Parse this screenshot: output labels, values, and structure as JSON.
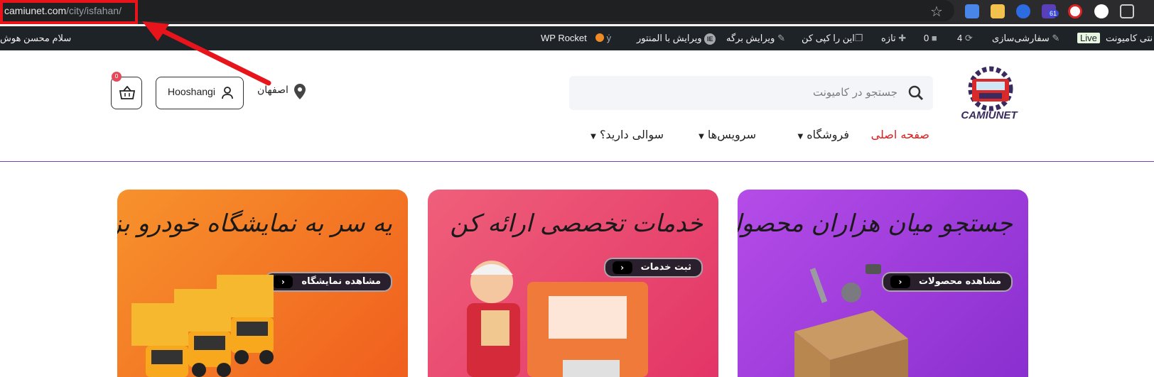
{
  "browser": {
    "url_domain": "camiunet.com",
    "url_path": "/city/isfahan/",
    "ext_badge": "61"
  },
  "adminbar": {
    "site_name": "نتی کامیونت",
    "live_label": "Live",
    "customize": "سفارشی‌سازی",
    "updates_count": "4",
    "comments_count": "0",
    "new": "تازه",
    "copy": "این را کپی کن",
    "edit_page": "ویرایش برگه",
    "edit_elementor": "ویرایش با المنتور",
    "wp_rocket": "WP Rocket",
    "greeting": "سلام محسن هوش"
  },
  "header": {
    "search_placeholder": "جستجو در کامیونت",
    "location": "اصفهان",
    "user_label": "Hooshangi",
    "cart_count": "0",
    "logo_text": "CAMIUNET"
  },
  "nav": {
    "home": "صفحه اصلی",
    "shop": "فروشگاه",
    "services": "سرویس‌ها",
    "faq": "سوالی دارید؟"
  },
  "cards": [
    {
      "title": "جستجو میان هزاران محصول",
      "button": "مشاهده محصولات",
      "color": "#9a3ad8"
    },
    {
      "title": "خدمات تخصصی ارائه کن",
      "button": "ثبت خدمات",
      "color": "#e8456c"
    },
    {
      "title": "یه سر به نمایشگاه خودرو بزن",
      "button": "مشاهده نمایشگاه",
      "color": "#f26a1f"
    }
  ],
  "colors": {
    "accent_red": "#e8141c",
    "nav_active": "#e01b1b",
    "divider_purple": "#7b3fb3"
  }
}
